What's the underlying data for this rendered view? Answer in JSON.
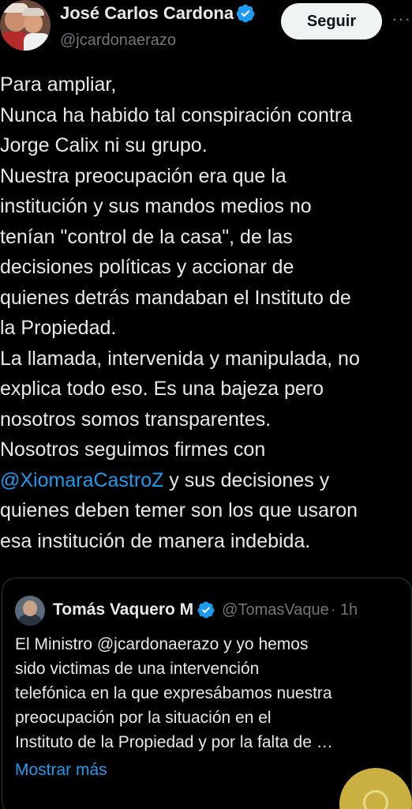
{
  "author": {
    "name": "José Carlos Cardona",
    "handle": "@jcardonaerazo"
  },
  "actions": {
    "follow_label": "Seguir",
    "more_label": "···"
  },
  "tweet": {
    "lines_before": "Para ampliar,\nNunca ha habido tal conspiración contra\nJorge Calix ni su grupo.\nNuestra preocupación era que la\ninstitución y sus mandos medios no\ntenían \"control de la casa\", de las\ndecisiones políticas y accionar de\nquienes detrás mandaban el Instituto de\nla Propiedad.\nLa llamada, intervenida y manipulada, no\nexplica todo eso. Es una bajeza pero\nnosotros somos transparentes.\nNosotros seguimos firmes con\n",
    "mention": "@XiomaraCastroZ",
    "lines_after": " y sus decisiones y\nquienes deben temer son los que usaron\nesa institución de manera indebida."
  },
  "quote": {
    "name": "Tomás Vaquero M",
    "handle": "@TomasVaque",
    "time": "· 1h",
    "text": "El Ministro @jcardonaerazo y yo hemos\nsido victimas de una intervención\ntelefónica en la que expresábamos nuestra\npreocupación por la situación en el\nInstituto de la Propiedad y por la falta de …",
    "show_more": "Mostrar más"
  },
  "colors": {
    "background": "#000000",
    "text": "#e7e9ea",
    "secondary": "#71767b",
    "link": "#1d9bf0",
    "verified": "#1d9bf0",
    "fab": "#c9b040"
  }
}
